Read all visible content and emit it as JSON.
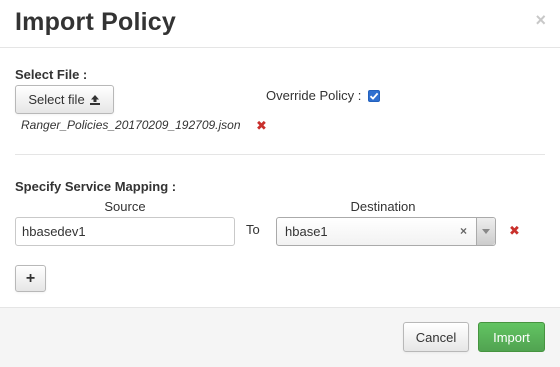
{
  "modal": {
    "title": "Import Policy",
    "close_glyph": "×"
  },
  "file_section": {
    "label": "Select File :",
    "select_button_label": "Select file",
    "selected_file": "Ranger_Policies_20170209_192709.json",
    "remove_glyph": "✖",
    "override_label": "Override Policy :",
    "override_checked": true
  },
  "mapping": {
    "label": "Specify Service Mapping :",
    "source_header": "Source",
    "destination_header": "Destination",
    "rows": [
      {
        "source": "hbasedev1",
        "to_label": "To",
        "destination": "hbase1"
      }
    ],
    "clear_glyph": "×",
    "remove_glyph": "✖",
    "add_glyph": "+"
  },
  "footer": {
    "cancel_label": "Cancel",
    "import_label": "Import"
  },
  "colors": {
    "accent_checkbox": "#2e6fd0",
    "remove_red": "#c9302c",
    "import_green": "#5bb75b"
  },
  "icons": [
    "close-icon",
    "upload-icon",
    "remove-icon",
    "clear-icon",
    "chevron-down-icon",
    "plus-icon"
  ]
}
